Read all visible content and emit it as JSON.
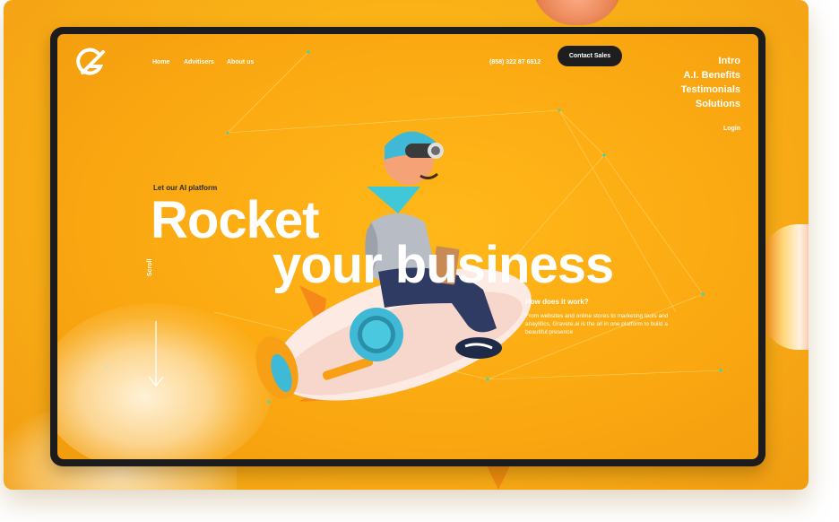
{
  "brand": {
    "logo_icon": "rocket-g-logo-icon",
    "accent": "#fba912",
    "dark": "#1e1e1e",
    "text_light": "#ffffff"
  },
  "nav": {
    "items": [
      "Home",
      "Advitisers",
      "About us"
    ]
  },
  "header": {
    "phone": "(858) 322 87 6512",
    "contact_label": "Contact Sales"
  },
  "side_menu": {
    "items": [
      "Intro",
      "A.I. Benefits",
      "Testimonials",
      "Solutions"
    ],
    "login": "Login"
  },
  "hero": {
    "kicker": "Let our AI platform",
    "headline_line1": "Rocket",
    "headline_line2": "your business",
    "scroll_label": "Scroll"
  },
  "info": {
    "title": "How does it work?",
    "text": "From websites and online stores to marketing tools and anaylitics, Gravete.ai is the all in one platform to build a beautiful presence"
  }
}
